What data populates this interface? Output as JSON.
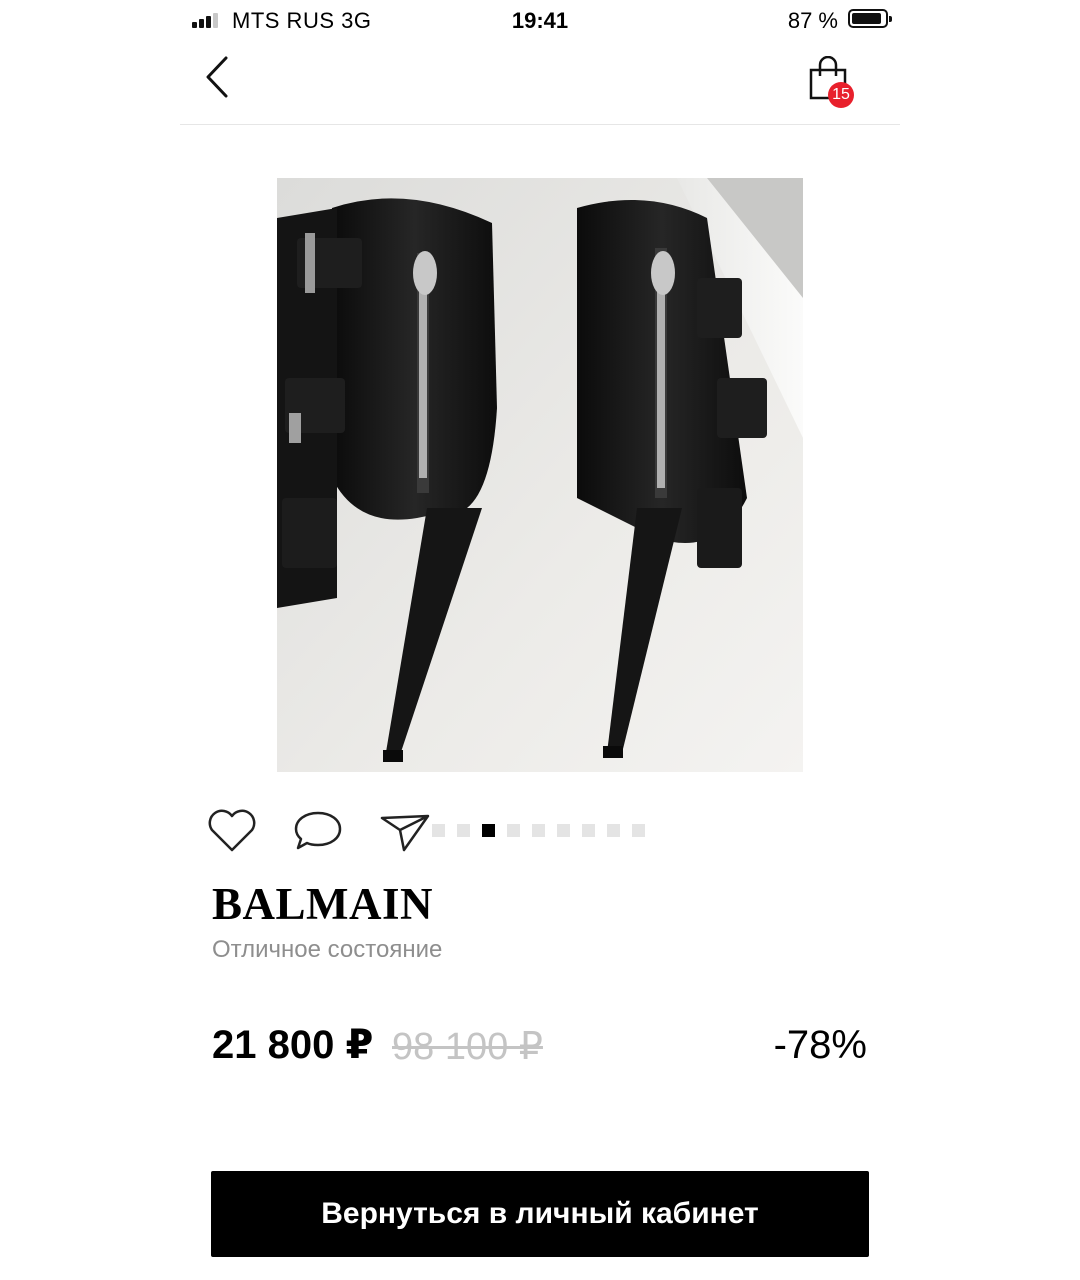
{
  "status_bar": {
    "carrier": "MTS RUS   3G",
    "time": "19:41",
    "battery": "87 %"
  },
  "nav": {
    "cart_count": "15"
  },
  "icons": {
    "back": "chevron-left-icon",
    "cart": "shopping-bag-icon",
    "like": "heart-icon",
    "comment": "chat-bubble-icon",
    "share": "send-icon"
  },
  "gallery": {
    "total": 9,
    "active_index": 2
  },
  "product": {
    "brand": "BALMAIN",
    "condition": "Отличное состояние",
    "price": "21 800 ₽",
    "old_price": "98 100 ₽",
    "discount": "-78%"
  },
  "cta": {
    "label": "Вернуться в личный кабинет"
  },
  "colors": {
    "badge": "#e8202c",
    "cta_bg": "#000000",
    "muted": "#8e8e8e"
  }
}
